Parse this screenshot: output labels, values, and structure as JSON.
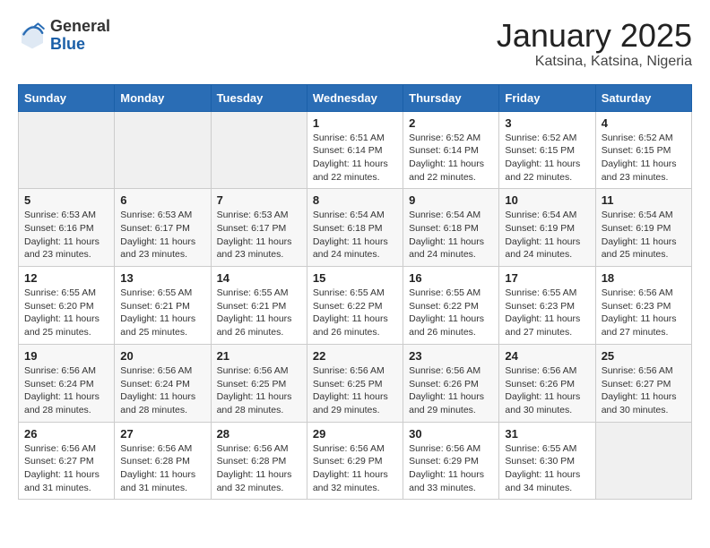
{
  "logo": {
    "general": "General",
    "blue": "Blue"
  },
  "title": "January 2025",
  "subtitle": "Katsina, Katsina, Nigeria",
  "days": [
    "Sunday",
    "Monday",
    "Tuesday",
    "Wednesday",
    "Thursday",
    "Friday",
    "Saturday"
  ],
  "weeks": [
    [
      {
        "num": "",
        "info": ""
      },
      {
        "num": "",
        "info": ""
      },
      {
        "num": "",
        "info": ""
      },
      {
        "num": "1",
        "info": "Sunrise: 6:51 AM\nSunset: 6:14 PM\nDaylight: 11 hours\nand 22 minutes."
      },
      {
        "num": "2",
        "info": "Sunrise: 6:52 AM\nSunset: 6:14 PM\nDaylight: 11 hours\nand 22 minutes."
      },
      {
        "num": "3",
        "info": "Sunrise: 6:52 AM\nSunset: 6:15 PM\nDaylight: 11 hours\nand 22 minutes."
      },
      {
        "num": "4",
        "info": "Sunrise: 6:52 AM\nSunset: 6:15 PM\nDaylight: 11 hours\nand 23 minutes."
      }
    ],
    [
      {
        "num": "5",
        "info": "Sunrise: 6:53 AM\nSunset: 6:16 PM\nDaylight: 11 hours\nand 23 minutes."
      },
      {
        "num": "6",
        "info": "Sunrise: 6:53 AM\nSunset: 6:17 PM\nDaylight: 11 hours\nand 23 minutes."
      },
      {
        "num": "7",
        "info": "Sunrise: 6:53 AM\nSunset: 6:17 PM\nDaylight: 11 hours\nand 23 minutes."
      },
      {
        "num": "8",
        "info": "Sunrise: 6:54 AM\nSunset: 6:18 PM\nDaylight: 11 hours\nand 24 minutes."
      },
      {
        "num": "9",
        "info": "Sunrise: 6:54 AM\nSunset: 6:18 PM\nDaylight: 11 hours\nand 24 minutes."
      },
      {
        "num": "10",
        "info": "Sunrise: 6:54 AM\nSunset: 6:19 PM\nDaylight: 11 hours\nand 24 minutes."
      },
      {
        "num": "11",
        "info": "Sunrise: 6:54 AM\nSunset: 6:19 PM\nDaylight: 11 hours\nand 25 minutes."
      }
    ],
    [
      {
        "num": "12",
        "info": "Sunrise: 6:55 AM\nSunset: 6:20 PM\nDaylight: 11 hours\nand 25 minutes."
      },
      {
        "num": "13",
        "info": "Sunrise: 6:55 AM\nSunset: 6:21 PM\nDaylight: 11 hours\nand 25 minutes."
      },
      {
        "num": "14",
        "info": "Sunrise: 6:55 AM\nSunset: 6:21 PM\nDaylight: 11 hours\nand 26 minutes."
      },
      {
        "num": "15",
        "info": "Sunrise: 6:55 AM\nSunset: 6:22 PM\nDaylight: 11 hours\nand 26 minutes."
      },
      {
        "num": "16",
        "info": "Sunrise: 6:55 AM\nSunset: 6:22 PM\nDaylight: 11 hours\nand 26 minutes."
      },
      {
        "num": "17",
        "info": "Sunrise: 6:55 AM\nSunset: 6:23 PM\nDaylight: 11 hours\nand 27 minutes."
      },
      {
        "num": "18",
        "info": "Sunrise: 6:56 AM\nSunset: 6:23 PM\nDaylight: 11 hours\nand 27 minutes."
      }
    ],
    [
      {
        "num": "19",
        "info": "Sunrise: 6:56 AM\nSunset: 6:24 PM\nDaylight: 11 hours\nand 28 minutes."
      },
      {
        "num": "20",
        "info": "Sunrise: 6:56 AM\nSunset: 6:24 PM\nDaylight: 11 hours\nand 28 minutes."
      },
      {
        "num": "21",
        "info": "Sunrise: 6:56 AM\nSunset: 6:25 PM\nDaylight: 11 hours\nand 28 minutes."
      },
      {
        "num": "22",
        "info": "Sunrise: 6:56 AM\nSunset: 6:25 PM\nDaylight: 11 hours\nand 29 minutes."
      },
      {
        "num": "23",
        "info": "Sunrise: 6:56 AM\nSunset: 6:26 PM\nDaylight: 11 hours\nand 29 minutes."
      },
      {
        "num": "24",
        "info": "Sunrise: 6:56 AM\nSunset: 6:26 PM\nDaylight: 11 hours\nand 30 minutes."
      },
      {
        "num": "25",
        "info": "Sunrise: 6:56 AM\nSunset: 6:27 PM\nDaylight: 11 hours\nand 30 minutes."
      }
    ],
    [
      {
        "num": "26",
        "info": "Sunrise: 6:56 AM\nSunset: 6:27 PM\nDaylight: 11 hours\nand 31 minutes."
      },
      {
        "num": "27",
        "info": "Sunrise: 6:56 AM\nSunset: 6:28 PM\nDaylight: 11 hours\nand 31 minutes."
      },
      {
        "num": "28",
        "info": "Sunrise: 6:56 AM\nSunset: 6:28 PM\nDaylight: 11 hours\nand 32 minutes."
      },
      {
        "num": "29",
        "info": "Sunrise: 6:56 AM\nSunset: 6:29 PM\nDaylight: 11 hours\nand 32 minutes."
      },
      {
        "num": "30",
        "info": "Sunrise: 6:56 AM\nSunset: 6:29 PM\nDaylight: 11 hours\nand 33 minutes."
      },
      {
        "num": "31",
        "info": "Sunrise: 6:55 AM\nSunset: 6:30 PM\nDaylight: 11 hours\nand 34 minutes."
      },
      {
        "num": "",
        "info": ""
      }
    ]
  ]
}
